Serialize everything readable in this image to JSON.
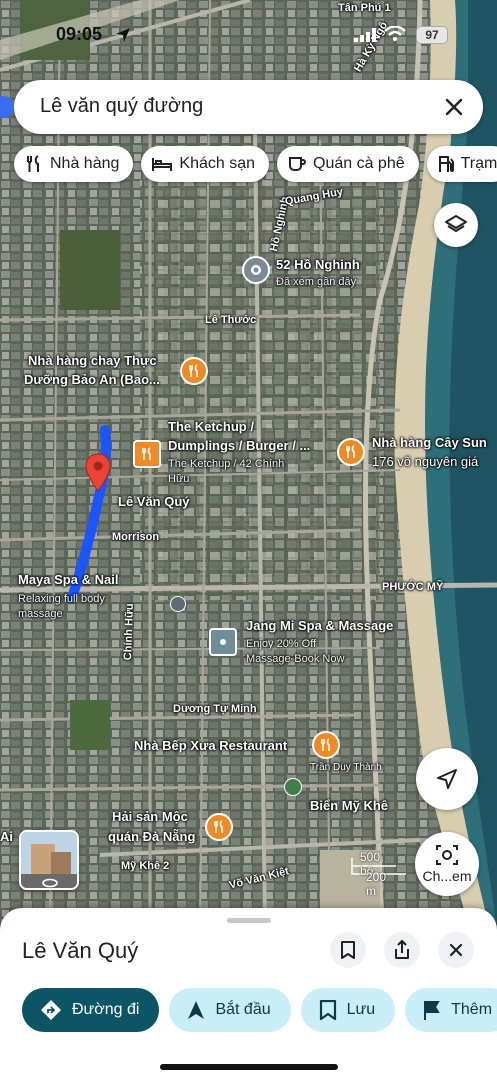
{
  "status_bar": {
    "time": "09:05",
    "battery": "97"
  },
  "search": {
    "query": "Lê văn quý đường"
  },
  "chips": [
    {
      "icon": "fork-knife-icon",
      "label": "Nhà hàng"
    },
    {
      "icon": "bed-icon",
      "label": "Khách sạn"
    },
    {
      "icon": "coffee-cup-icon",
      "label": "Quán cà phê"
    },
    {
      "icon": "gas-station-icon",
      "label": "Trạm"
    }
  ],
  "map": {
    "streets": {
      "le_thuoc": "Lê Thước",
      "morrison": "Morrison",
      "phuoc_my": "PHƯỚC MỸ",
      "duong_tu_minh": "Dương Tự Minh",
      "chinh_huu": "Chính Hữu",
      "my_khe_2": "Mỹ Khê 2",
      "vo_van_kiet": "Võ Văn Kiệt",
      "ho_nghinh": "Hồ Nghinh",
      "quang_huy": "Quang Huy",
      "ha_ky_ngo": "Hà Kỳ Ngộ",
      "tan_phu": "Tân Phú 1",
      "tran_duy_thanh": "Trần Duy Thành"
    },
    "places": {
      "p52": {
        "name": "52 Hồ Nghinh",
        "sub": "Đã xem gần đây"
      },
      "chay": {
        "name1": "Nhà hàng chay Thực",
        "name2": "Dưỡng Bảo An (Bao..."
      },
      "ketchup": {
        "name1": "The Ketchup /",
        "name2": "Dumplings / Burger / ...",
        "sub1": "The Ketchup / 42 Chính",
        "sub2": "Hữu"
      },
      "cay_sung": {
        "name1": "Nhà hàng Cây Sun",
        "sub": "176 võ nguyên giá"
      },
      "pin": {
        "name": "Lê Văn Quý"
      },
      "maya": {
        "name": "Maya Spa & Nail",
        "sub1": "Relaxing full body",
        "sub2": "massage"
      },
      "jangmi": {
        "name": "Jang Mi Spa & Massage",
        "sub1": "Enjoy 20% Off",
        "sub2": "Massage-Book Now"
      },
      "bep_xua": {
        "name": "Nhà Bếp Xưa Restaurant"
      },
      "my_khe": {
        "name": "Biển Mỹ Khê"
      },
      "hai_san": {
        "name1": "Hải sản Mộc",
        "name2": "quán Đà Nẵng"
      },
      "ai": {
        "name": "Ai"
      }
    },
    "scale": {
      "top": "500 bộ",
      "bottom": "200 m"
    },
    "lens_label": "Ch...em"
  },
  "sheet": {
    "title": "Lê Văn Quý",
    "actions": [
      {
        "icon": "directions-icon",
        "label": "Đường đi"
      },
      {
        "icon": "navigation-arrow-icon",
        "label": "Bắt đầu"
      },
      {
        "icon": "bookmark-icon",
        "label": "Lưu"
      },
      {
        "icon": "flag-icon",
        "label": "Thêm"
      }
    ]
  },
  "colors": {
    "route": "#1a55ff",
    "pin": "#ea4335",
    "poi_orange": "#f08a24",
    "primary_btn": "#0b5565",
    "secondary_btn": "#c9eef7"
  }
}
